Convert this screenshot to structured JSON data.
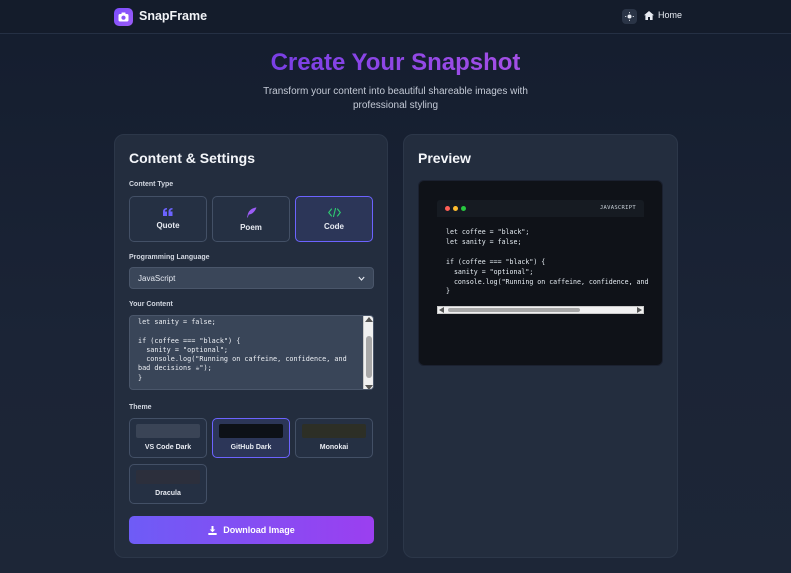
{
  "header": {
    "brand": "SnapFrame",
    "home_label": "Home"
  },
  "hero": {
    "title": "Create Your Snapshot",
    "subtitle": "Transform your content into beautiful shareable images with professional styling"
  },
  "settings": {
    "title": "Content & Settings",
    "content_type_label": "Content Type",
    "content_types": [
      {
        "label": "Quote",
        "icon": "quote-icon",
        "active": false
      },
      {
        "label": "Poem",
        "icon": "feather-icon",
        "active": false
      },
      {
        "label": "Code",
        "icon": "code-icon",
        "active": true
      }
    ],
    "language_label": "Programming Language",
    "language_value": "JavaScript",
    "content_label": "Your Content",
    "content_value": "let sanity = false;\n\nif (coffee === \"black\") {\n  sanity = \"optional\";\n  console.log(\"Running on caffeine, confidence, and bad decisions ☕\");\n}",
    "theme_label": "Theme",
    "themes": [
      {
        "label": "VS Code Dark",
        "swatch": "#3a4456",
        "active": false
      },
      {
        "label": "GitHub Dark",
        "swatch": "#0d1117",
        "active": true
      },
      {
        "label": "Monokai",
        "swatch": "#2d2f26",
        "active": false
      },
      {
        "label": "Dracula",
        "swatch": "#2c2f3c",
        "active": false
      }
    ],
    "download_label": "Download Image"
  },
  "preview": {
    "title": "Preview",
    "language_tag": "JAVASCRIPT",
    "code": "let coffee = \"black\";\nlet sanity = false;\n\nif (coffee === \"black\") {\n  sanity = \"optional\";\n  console.log(\"Running on caffeine, confidence, and\n}"
  },
  "colors": {
    "accent": "#6c63ff",
    "brand_gradient_start": "#7a3fe6",
    "brand_gradient_end": "#a44fe6",
    "dot_red": "#ff5f56",
    "dot_yellow": "#ffbd2e",
    "dot_green": "#27c93f"
  }
}
